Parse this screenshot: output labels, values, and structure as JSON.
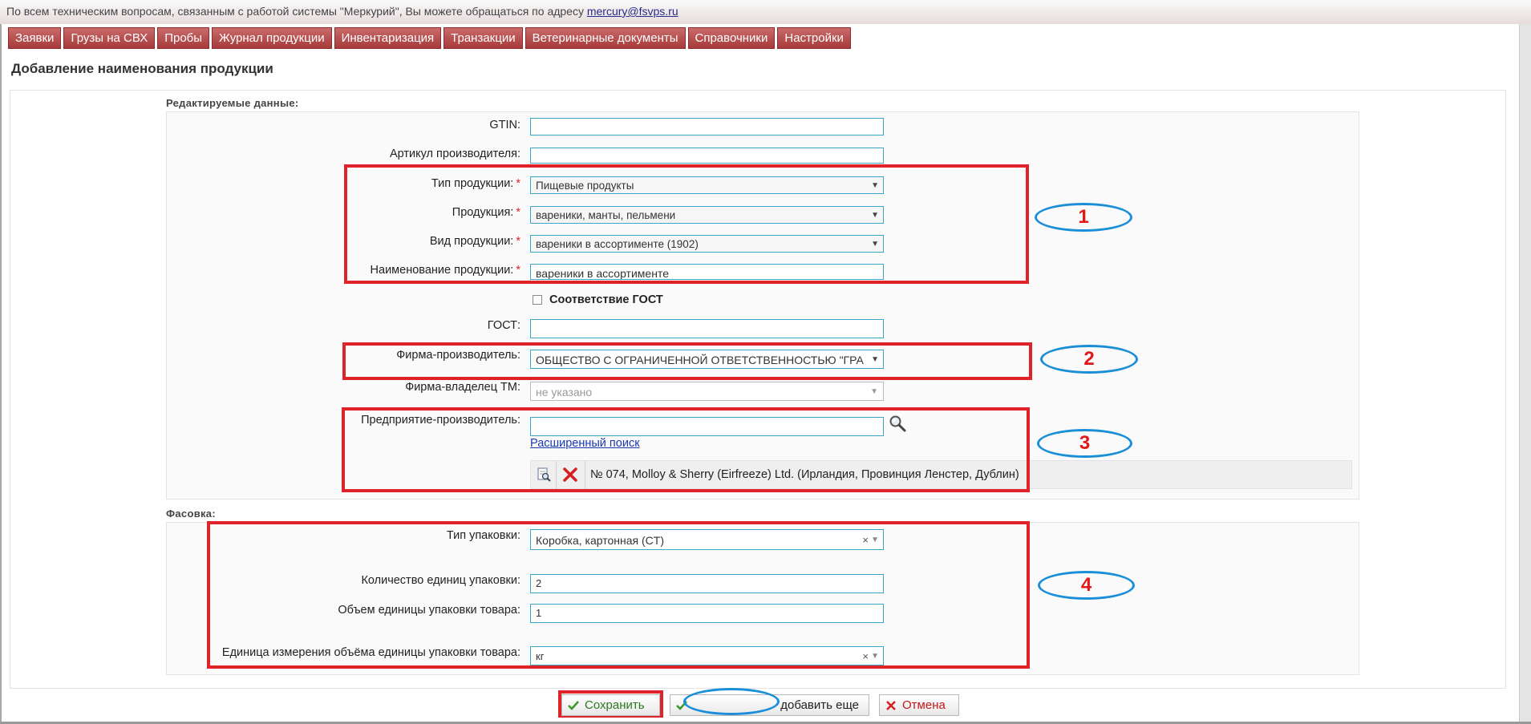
{
  "info_bar": {
    "text": "По всем техническим вопросам, связанным с работой системы \"Меркурий\", Вы можете обращаться по адресу",
    "email": "mercury@fsvps.ru"
  },
  "menu": [
    "Заявки",
    "Грузы на СВХ",
    "Пробы",
    "Журнал продукции",
    "Инвентаризация",
    "Транзакции",
    "Ветеринарные документы",
    "Справочники",
    "Настройки"
  ],
  "page_title": "Добавление наименования продукции",
  "sections": {
    "editable": "Редактируемые данные:",
    "packaging": "Фасовка:"
  },
  "form": {
    "gtin": {
      "label": "GTIN:",
      "value": ""
    },
    "article": {
      "label": "Артикул производителя:",
      "value": ""
    },
    "product_type": {
      "label": "Тип продукции:",
      "value": "Пищевые продукты"
    },
    "product": {
      "label": "Продукция:",
      "value": "вареники, манты, пельмени"
    },
    "product_kind": {
      "label": "Вид продукции:",
      "value": "вареники в ассортименте (1902)"
    },
    "product_name": {
      "label": "Наименование продукции:",
      "value": "вареники в ассортименте"
    },
    "gost_check": {
      "label": "Соответствие ГОСТ",
      "checked": false
    },
    "gost": {
      "label": "ГОСТ:",
      "value": ""
    },
    "manufacturer_firm": {
      "label": "Фирма-производитель:",
      "value": "ОБЩЕСТВО С ОГРАНИЧЕННОЙ ОТВЕТСТВЕННОСТЬЮ \"ГРА"
    },
    "tm_owner": {
      "label": "Фирма-владелец ТМ:",
      "value": "не указано"
    },
    "enterprise": {
      "label": "Предприятие-производитель:",
      "value": "",
      "extended_search": "Расширенный поиск",
      "selected": "№ 074, Molloy & Sherry (Eirfreeze) Ltd. (Ирландия, Провинция Ленстер, Дублин)"
    },
    "package_type": {
      "label": "Тип упаковки:",
      "value": "Коробка, картонная (CT)"
    },
    "package_count": {
      "label": "Количество единиц упаковки:",
      "value": "2"
    },
    "package_volume": {
      "label": "Объем единицы упаковки товара:",
      "value": "1"
    },
    "volume_unit": {
      "label": "Единица измерения объёма единицы упаковки товара:",
      "value": "кг"
    }
  },
  "annotations": [
    "1",
    "2",
    "3",
    "4"
  ],
  "required_mark": "*",
  "buttons": {
    "save": "Сохранить",
    "save_add": "добавить еще",
    "cancel": "Отмена"
  },
  "colors": {
    "menu_bg": "#b04545",
    "annotation_box": "#e0222b",
    "annotation_oval": "#1a8fd8",
    "field_border": "#3aa6c8",
    "required": "#dd2222"
  }
}
